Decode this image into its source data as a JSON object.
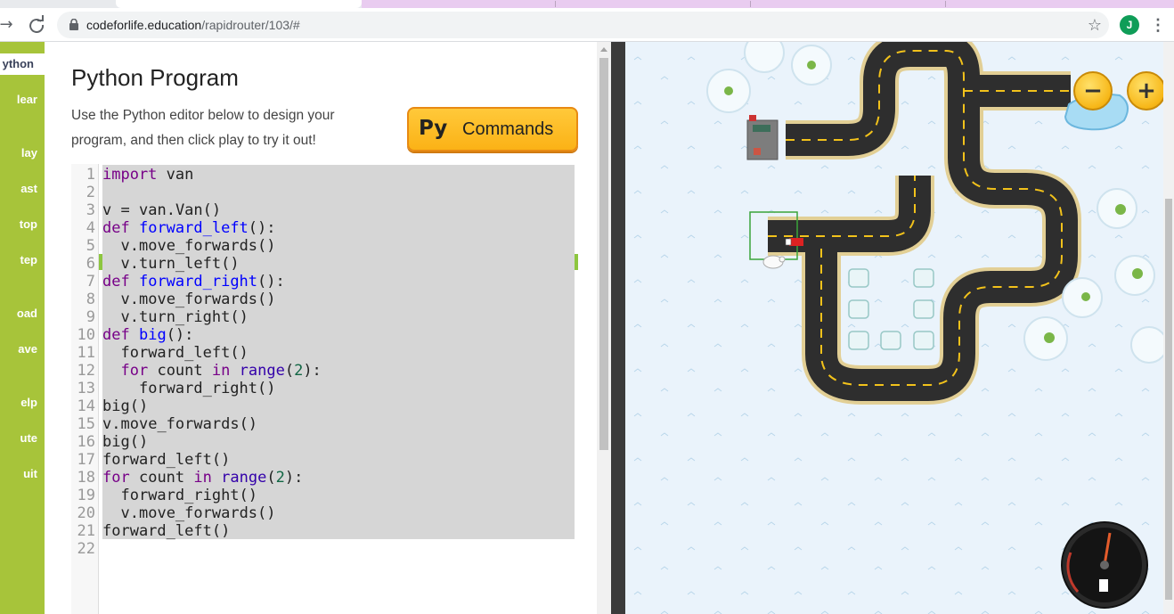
{
  "browser": {
    "url_host": "codeforlife.education",
    "url_path": "/rapidrouter/103/#",
    "profile_initial": "J",
    "back_glyph": "→",
    "reload_glyph": "C",
    "star_glyph": "☆",
    "menu_glyph": "⋮"
  },
  "sidebar": {
    "items": [
      {
        "label": "ython",
        "active": true
      },
      {
        "label": "lear"
      },
      {
        "label": "lay"
      },
      {
        "label": "ast"
      },
      {
        "label": "top"
      },
      {
        "label": "tep"
      },
      {
        "label": "oad"
      },
      {
        "label": "ave"
      },
      {
        "label": "elp"
      },
      {
        "label": "ute"
      },
      {
        "label": "uit"
      }
    ]
  },
  "panel": {
    "title": "Python Program",
    "description": "Use the Python editor below to design your program, and then click play to try it out!",
    "commands_prefix": "Py",
    "commands_label": "Commands"
  },
  "editor": {
    "line_numbers": [
      "1",
      "2",
      "3",
      "4",
      "5",
      "6",
      "7",
      "8",
      "9",
      "10",
      "11",
      "12",
      "13",
      "14",
      "15",
      "16",
      "17",
      "18",
      "19",
      "20",
      "21",
      "22"
    ],
    "lines": [
      "import van",
      "",
      "v = van.Van()",
      "def forward_left():",
      "  v.move_forwards()",
      "  v.turn_left()",
      "def forward_right():",
      "  v.move_forwards()",
      "  v.turn_right()",
      "def big():",
      "  forward_left()",
      "  for count in range(2):",
      "    forward_right()",
      "big()",
      "v.move_forwards()",
      "big()",
      "forward_left()",
      "for count in range(2):",
      "  forward_right()",
      "  v.move_forwards()",
      "forward_left()",
      ""
    ]
  },
  "map": {
    "zoom_out_label": "−",
    "zoom_in_label": "+",
    "colors": {
      "road": "#2e2e2e",
      "road_edge": "#e2cf95",
      "lane": "#f2c21b",
      "ground": "#eaf3fb",
      "highlight": "#3aa53a"
    }
  }
}
